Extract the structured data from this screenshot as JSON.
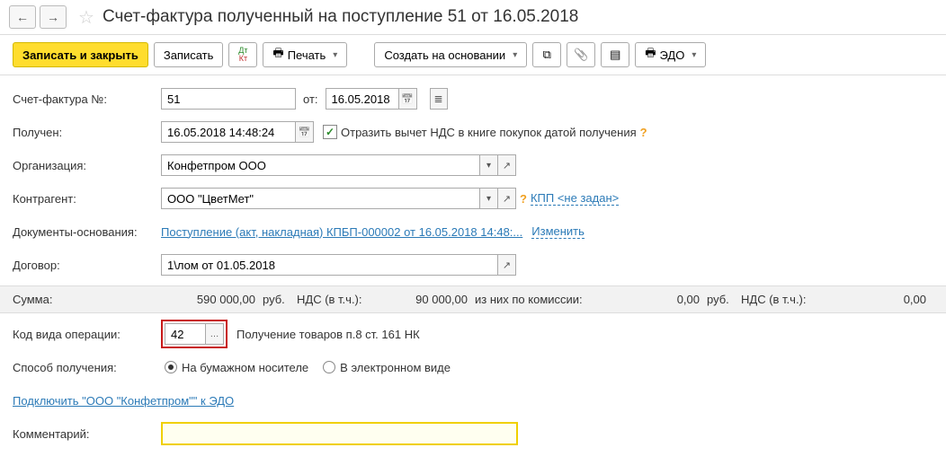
{
  "header": {
    "title": "Счет-фактура полученный на поступление 51 от 16.05.2018"
  },
  "toolbar": {
    "save_close": "Записать и закрыть",
    "save": "Записать",
    "print": "Печать",
    "create_based": "Создать на основании",
    "edo": "ЭДО"
  },
  "fields": {
    "invoice_no_label": "Счет-фактура №:",
    "invoice_no": "51",
    "from_label": "от:",
    "invoice_date": "16.05.2018",
    "received_label": "Получен:",
    "received_datetime": "16.05.2018 14:48:24",
    "reflect_vat": "Отразить вычет НДС в книге покупок датой получения",
    "org_label": "Организация:",
    "org": "Конфетпром ООО",
    "counterparty_label": "Контрагент:",
    "counterparty": "ООО \"ЦветМет\"",
    "kpp_link": "КПП <не задан>",
    "basis_label": "Документы-основания:",
    "basis_doc": "Поступление (акт, накладная) КПБП-000002 от 16.05.2018 14:48:...",
    "change": "Изменить",
    "contract_label": "Договор:",
    "contract": "1\\лом от 01.05.2018",
    "opcode_label": "Код вида операции:",
    "opcode": "42",
    "opcode_desc": "Получение товаров п.8 ст. 161 НК",
    "receive_method_label": "Способ получения:",
    "paper": "На бумажном носителе",
    "electronic": "В электронном виде",
    "connect_edo": "Подключить \"ООО \"Конфетпром\"\" к ЭДО",
    "comment_label": "Комментарий:",
    "comment": ""
  },
  "summary": {
    "sum_label": "Сумма:",
    "sum_value": "590 000,00",
    "rub": "руб.",
    "vat_in": "НДС (в т.ч.):",
    "vat_value": "90 000,00",
    "commission": "из них по комиссии:",
    "commission_value": "0,00",
    "vat2_value": "0,00"
  }
}
